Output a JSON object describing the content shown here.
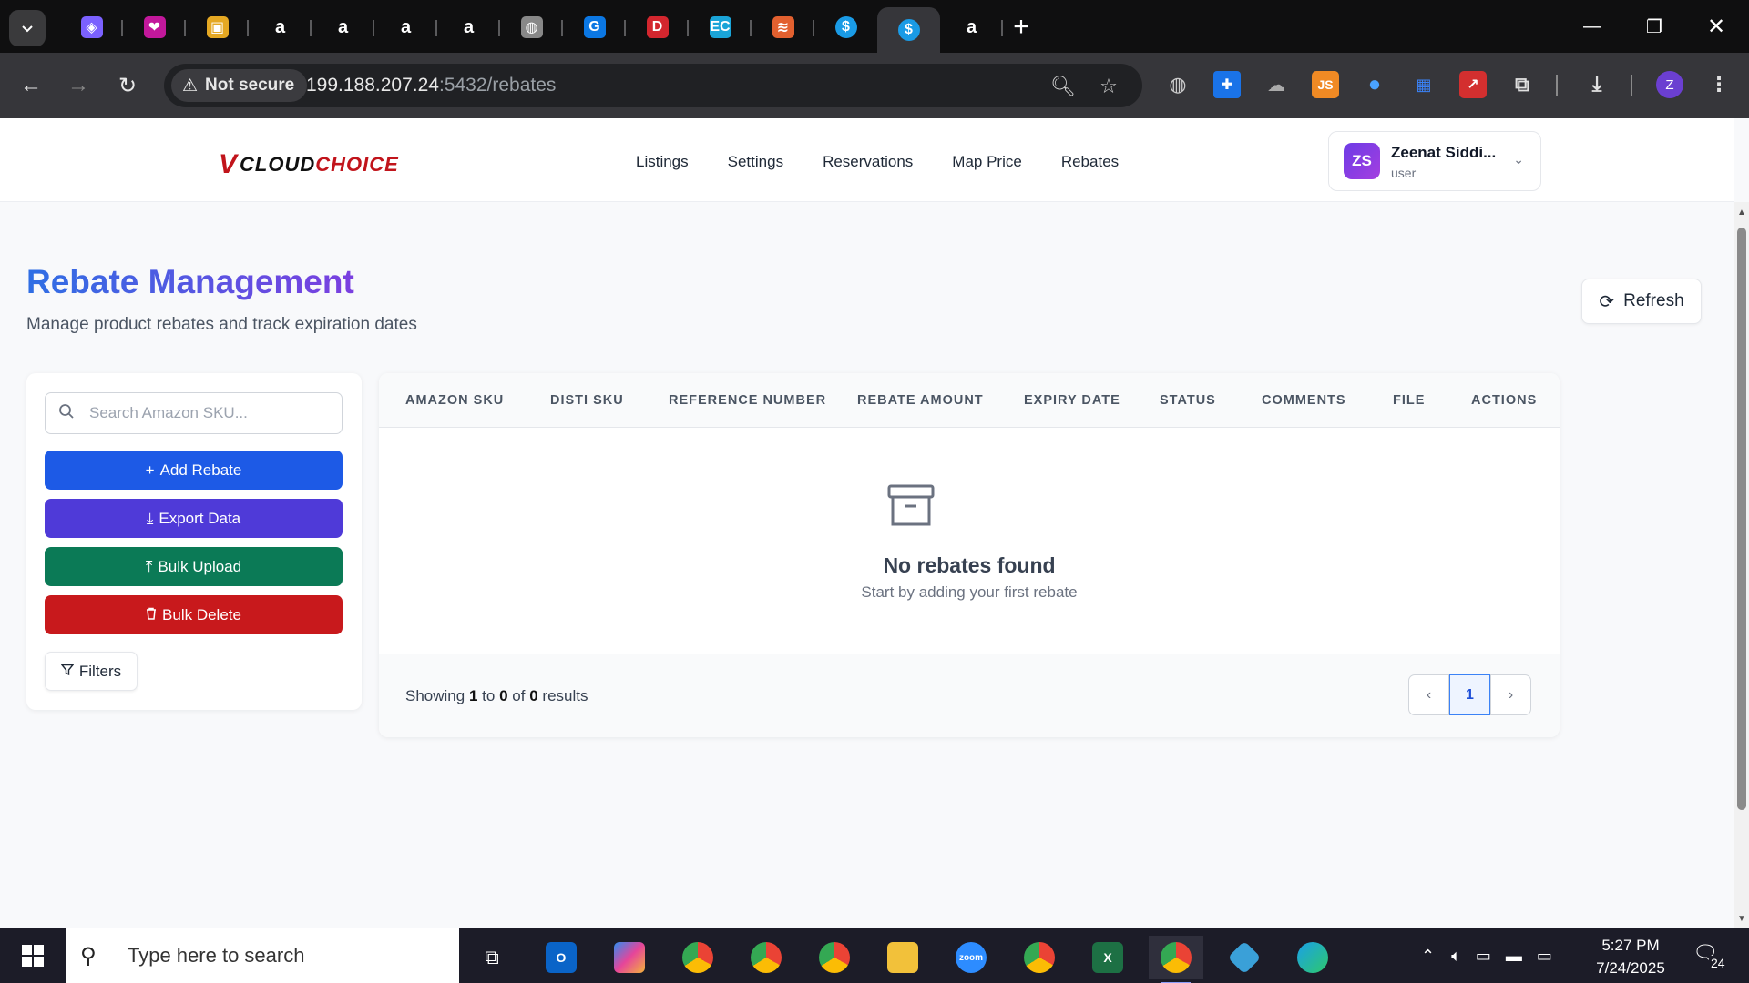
{
  "browser": {
    "tabs": [
      {
        "icon": "cube-icon",
        "color": "#7b61ff"
      },
      {
        "icon": "heart-app-icon",
        "color": "#c2189b"
      },
      {
        "icon": "box-icon",
        "color": "#e5a823"
      },
      {
        "icon": "amazon-icon",
        "color": "#ffffff"
      },
      {
        "icon": "amazon-icon",
        "color": "#ffffff"
      },
      {
        "icon": "amazon-icon",
        "color": "#ffffff"
      },
      {
        "icon": "amazon-icon",
        "color": "#ffffff"
      },
      {
        "icon": "globe-icon",
        "color": "#888888"
      },
      {
        "icon": "g-app-icon",
        "color": "#0b77e3"
      },
      {
        "icon": "dh-icon",
        "color": "#d3262e"
      },
      {
        "icon": "ec-icon",
        "color": "#1aa4d8"
      },
      {
        "icon": "layers-icon",
        "color": "#e2602f"
      },
      {
        "icon": "dollar-icon",
        "color": "#1a9be6"
      },
      {
        "icon": "dollar-icon",
        "color": "#1a9be6",
        "active": true
      },
      {
        "icon": "amazon-icon",
        "color": "#ffffff"
      }
    ],
    "security_label": "Not secure",
    "url_host": "199.188.207.24",
    "url_path": ":5432/rebates",
    "profile_initial": "Z"
  },
  "header": {
    "logo": {
      "v": "V",
      "part1": "CLOUD",
      "part2": "CHOICE"
    },
    "nav": [
      "Listings",
      "Settings",
      "Reservations",
      "Map Price",
      "Rebates"
    ],
    "user": {
      "initials": "ZS",
      "name": "Zeenat Siddi...",
      "role": "user"
    }
  },
  "page": {
    "title": "Rebate Management",
    "subtitle": "Manage product rebates and track expiration dates",
    "refresh_label": "Refresh"
  },
  "sidebar": {
    "search_placeholder": "Search Amazon SKU...",
    "buttons": [
      {
        "label": "Add Rebate",
        "glyph": "+",
        "color": "#1d5ae6"
      },
      {
        "label": "Export Data",
        "glyph": "⤓",
        "color": "#4f3ad8"
      },
      {
        "label": "Bulk Upload",
        "glyph": "⤒",
        "color": "#0b7a56"
      },
      {
        "label": "Bulk Delete",
        "glyph": "🗑",
        "color": "#c8191c"
      }
    ],
    "filters_label": "Filters"
  },
  "table": {
    "columns": [
      "AMAZON SKU",
      "DISTI SKU",
      "REFERENCE NUMBER",
      "REBATE AMOUNT",
      "EXPIRY DATE",
      "STATUS",
      "COMMENTS",
      "FILE",
      "ACTIONS"
    ],
    "empty_title": "No rebates found",
    "empty_subtitle": "Start by adding your first rebate",
    "footer": {
      "showing": "Showing",
      "from": "1",
      "to_word": "to",
      "to": "0",
      "of_word": "of",
      "total": "0",
      "results": "results"
    },
    "current_page": "1"
  },
  "taskbar": {
    "search_placeholder": "Type here to search",
    "time": "5:27 PM",
    "date": "7/24/2025",
    "notification_count": "24"
  }
}
